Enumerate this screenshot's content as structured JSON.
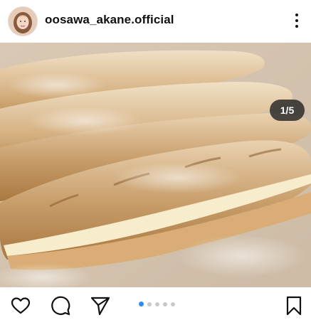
{
  "post": {
    "username": "oosawa_akane.official",
    "avatar_icon": "profile-photo",
    "more_icon": "more-vertical-icon",
    "carousel_counter": "1/5",
    "carousel": {
      "total": 5,
      "active_index": 0,
      "active_color": "#2e8df5",
      "inactive_color": "#c8c8c8"
    },
    "photo_subject": "baked bread loaves dusted with flour",
    "actions": {
      "like_icon": "heart-icon",
      "comment_icon": "comment-icon",
      "share_icon": "send-icon",
      "save_icon": "bookmark-icon"
    }
  }
}
